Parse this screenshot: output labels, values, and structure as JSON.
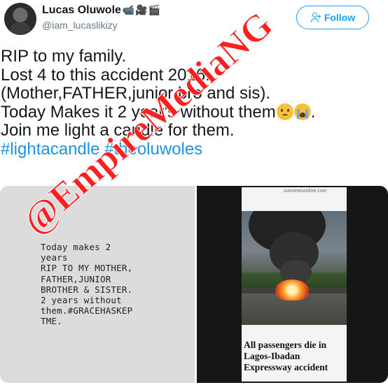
{
  "header": {
    "display_name": "Lucas Oluwole",
    "name_emojis": "📹🎥🎬",
    "handle": "@iam_lucaslikizy",
    "follow_label": "Follow"
  },
  "tweet": {
    "line1": "RIP  to my family.",
    "line2": "Lost 4 to this accident 2016.",
    "line3": "(Mother,FATHER,junior bro and sis).",
    "line4": "Today Makes it 2 year's without them",
    "line4_end": ".",
    "line5": "Join me light a candle for them.",
    "hashtag1": "#lightacandle",
    "hashtag2": "#theoluwoles"
  },
  "media": {
    "left_note": "Today makes 2\nyears\nRIP TO MY MOTHER,\nFATHER,JUNIOR\nBROTHER & SISTER.\n2 years without\nthem.#GRACEHASKEP\nTME.",
    "news_site": "sunnewsonline.com",
    "news_headline": "All passengers die in\nLagos-Ibadan\nExpressway accident"
  },
  "watermark": "@EmpireMediaNG",
  "colors": {
    "accent": "#1da1f2",
    "hashtag": "#1b95e0",
    "watermark": "#ff1f1f"
  },
  "icons": {
    "follow": "add-user-icon",
    "emoji1": "sad-face-emoji",
    "emoji2": "crying-face-emoji"
  }
}
